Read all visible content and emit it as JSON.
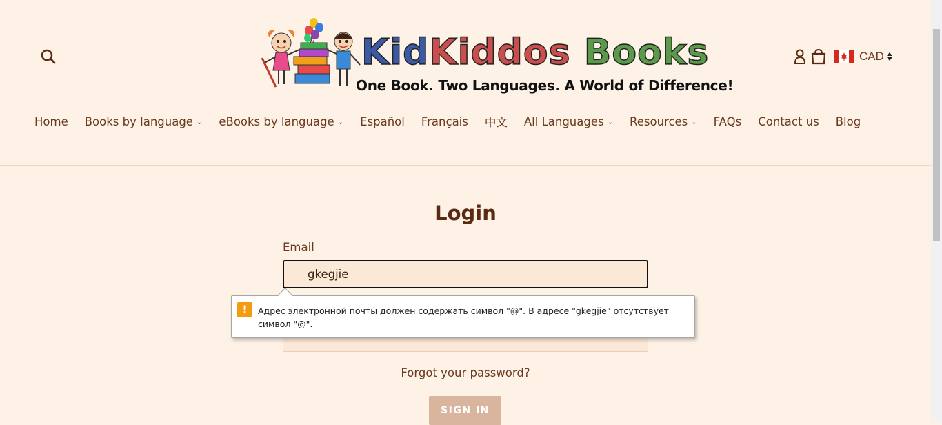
{
  "header": {
    "search_icon": "search-icon",
    "logo": {
      "name_part1": "Kid",
      "name_part2": "Kiddos",
      "name_part3": "Books",
      "tagline": "One Book. Two Languages. A World of Difference!"
    },
    "account_icon": "user-icon",
    "cart_icon": "shopping-bag-icon",
    "currency": {
      "flag": "canada-flag-icon",
      "code": "CAD"
    }
  },
  "nav": {
    "items": [
      {
        "label": "Home",
        "has_dropdown": false
      },
      {
        "label": "Books by language",
        "has_dropdown": true
      },
      {
        "label": "eBooks by language",
        "has_dropdown": true
      },
      {
        "label": "Español",
        "has_dropdown": false
      },
      {
        "label": "Français",
        "has_dropdown": false
      },
      {
        "label": "中文",
        "has_dropdown": false
      },
      {
        "label": "All Languages",
        "has_dropdown": true
      },
      {
        "label": "Resources",
        "has_dropdown": true
      },
      {
        "label": "FAQs",
        "has_dropdown": false
      },
      {
        "label": "Contact us",
        "has_dropdown": false
      },
      {
        "label": "Blog",
        "has_dropdown": false
      }
    ]
  },
  "login": {
    "title": "Login",
    "email_label": "Email",
    "email_value": "gkegjie",
    "validation_message": "Адрес электронной почты должен содержать символ \"@\". В адресе \"gkegjie\" отсутствует символ \"@\".",
    "forgot_password": "Forgot your password?",
    "sign_in": "SIGN IN"
  },
  "colors": {
    "background": "#fdf2e5",
    "text": "#6b3a1f",
    "button": "#d9b59e",
    "warning": "#f39c12"
  }
}
